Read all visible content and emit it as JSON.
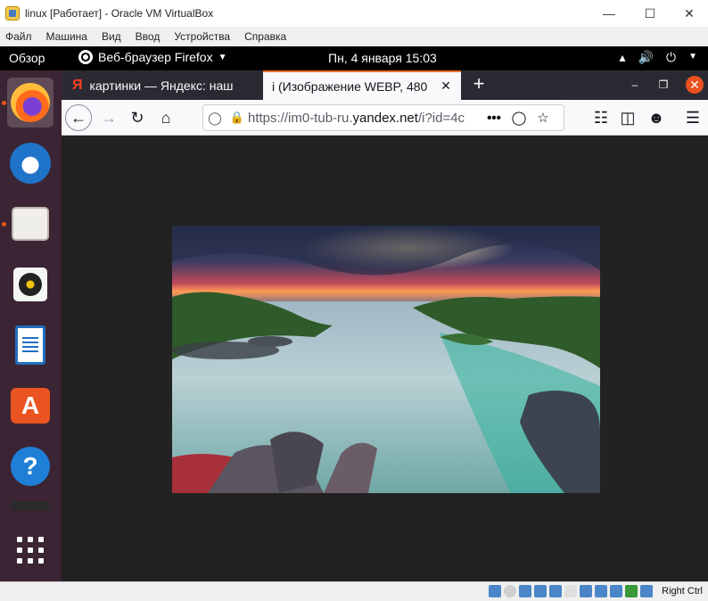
{
  "vbox": {
    "title": "linux [Работает] - Oracle VM VirtualBox",
    "menu": [
      "Файл",
      "Машина",
      "Вид",
      "Ввод",
      "Устройства",
      "Справка"
    ],
    "host_key": "Right Ctrl"
  },
  "gnome": {
    "overview": "Обзор",
    "app_menu": "Веб-браузер Firefox",
    "clock": "Пн, 4 января  15:03"
  },
  "dock": {
    "apps": [
      "firefox-icon",
      "thunderbird-icon",
      "files-icon",
      "rhythmbox-icon",
      "libreoffice-writer-icon",
      "ubuntu-software-icon",
      "help-icon"
    ]
  },
  "firefox": {
    "tabs": [
      {
        "label": "картинки — Яндекс: наш"
      },
      {
        "label": "i (Изображение WEBP, 480"
      }
    ],
    "url": {
      "prefix": "https://im0-tub-ru.",
      "domain": "yandex.net",
      "suffix": "/i?id=4c"
    }
  },
  "image_colors": {
    "page_bg": "#222222",
    "accent": "#e95420"
  }
}
